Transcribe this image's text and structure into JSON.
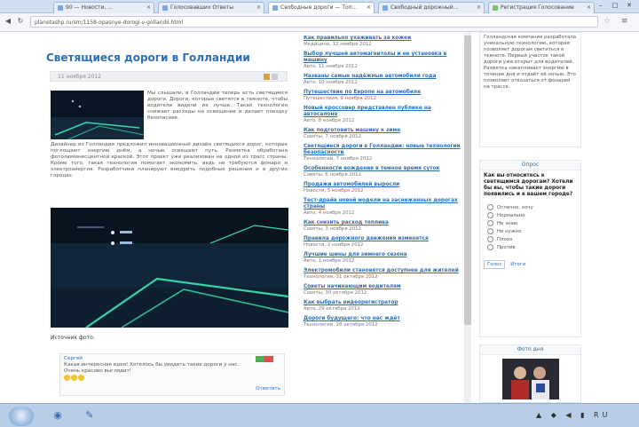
{
  "browser": {
    "tabs": [
      {
        "label": "90 — Новости, ..."
      },
      {
        "label": "Голосовавших Ответы"
      },
      {
        "label": "Свободные дороги — Топ..."
      },
      {
        "label": "Свободный дорожный..."
      },
      {
        "label": "Регистрация Голосование"
      }
    ],
    "address": "planetashp.ru/sm/1158-opasnye-dorogi-v-gollandii.html",
    "window_controls": {
      "minimize": "–",
      "maximize": "□",
      "close": "✕"
    }
  },
  "article": {
    "title": "Светящиеся дороги в Голландии",
    "meta": "11 ноября 2012",
    "paragraph1": "Мы слышали, в Голландии теперь есть светящиеся дороги. Дороги, которые светятся в темноте, чтобы водители видели их лучше. Такая технология снижает расходы на освещение и делает поездку безопаснее.",
    "paragraph2": "Дизайнер из Голландии предложил инновационный дизайн светящихся дорог, которые поглощают энергию днём, а ночью освещают путь. Разметка обработана фотолюминесцентной краской. Этот проект уже реализован на одной из трасс страны. Кроме того, такая технология помогает экономить, ведь не требуются фонари и электроэнергия. Разработчики планируют внедрить подобные решения и в других городах.",
    "caption": "Источник фото:",
    "comment": {
      "author": "Сергей",
      "text": "Какая интересная идея! Хотелось бы увидеть такие дороги у нас. Очень красиво выглядит!",
      "more": "Ответить"
    }
  },
  "news": [
    {
      "title": "Как правильно ухаживать за кожей",
      "date": "Медицина, 12 ноября 2012"
    },
    {
      "title": "Выбор лучшей автомагнитолы и ее установка в машину",
      "date": "Авто, 11 ноября 2012"
    },
    {
      "title": "Названы самые надёжные автомобили года",
      "date": "Авто, 10 ноября 2012"
    },
    {
      "title": "Путешествие по Европе на автомобиле",
      "date": "Путешествия, 9 ноября 2012"
    },
    {
      "title": "Новый кроссовер представлен публике на автосалоне",
      "date": "Авто, 8 ноября 2012"
    },
    {
      "title": "Как подготовить машину к зиме",
      "date": "Советы, 7 ноября 2012"
    },
    {
      "title": "Светящиеся дороги в Голландии: новые технологии безопасности",
      "date": "Технологии, 7 ноября 2012"
    },
    {
      "title": "Особенности вождения в темное время суток",
      "date": "Советы, 6 ноября 2012"
    },
    {
      "title": "Продажи автомобилей выросли",
      "date": "Новости, 5 ноября 2012"
    },
    {
      "title": "Тест-драйв новой модели на заснеженных дорогах страны",
      "date": "Авто, 4 ноября 2012"
    },
    {
      "title": "Как снизить расход топлива",
      "date": "Советы, 3 ноября 2012"
    },
    {
      "title": "Правила дорожного движения изменятся",
      "date": "Новости, 2 ноября 2012"
    },
    {
      "title": "Лучшие шины для зимнего сезона",
      "date": "Авто, 1 ноября 2012"
    },
    {
      "title": "Электромобили становятся доступнее для жителей",
      "date": "Технологии, 31 октября 2012"
    },
    {
      "title": "Советы начинающим водителям",
      "date": "Советы, 30 октября 2012"
    },
    {
      "title": "Как выбрать видеорегистратор",
      "date": "Авто, 29 октября 2012"
    },
    {
      "title": "Дороги будущего: что нас ждёт",
      "date": "Технологии, 28 октября 2012"
    }
  ],
  "sidebar": {
    "text_block": "Голландская компания разработала уникальную технологию, которая позволяет дорогам светиться в темноте. Первый участок такой дороги уже открыт для водителей. Разметка накапливает энергию в течение дня и отдаёт её ночью. Это позволяет отказаться от фонарей на трассе.",
    "poll": {
      "header": "Опрос",
      "question": "Как вы относитесь к светящимся дорогам? Хотели бы вы, чтобы такие дороги появились и в вашем городе?",
      "options": [
        "Отлично, хочу",
        "Нормально",
        "Не знаю",
        "Не нужно",
        "Плохо",
        "Против"
      ],
      "vote": "Голос",
      "results": "Итоги"
    },
    "photo_header": "Фото дня"
  },
  "taskbar": {
    "tray": "▲ ◆ ◀ ▮ RU"
  }
}
